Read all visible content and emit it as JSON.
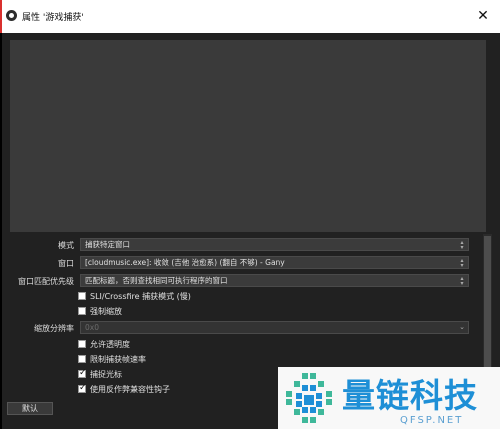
{
  "window": {
    "title": "属性 '游戏捕获'",
    "close": "✕"
  },
  "properties": {
    "mode": {
      "label": "模式",
      "value": "捕获特定窗口"
    },
    "window": {
      "label": "窗口",
      "value": "[cloudmusic.exe]: 收敛 (吉他 治愈系) (翻自 不够) - Gany"
    },
    "match_priority": {
      "label": "窗口匹配优先级",
      "value": "匹配标题，否则查找相同可执行程序的窗口"
    },
    "sli_crossfire": {
      "label": "SLI/Crossfire 捕获模式 (慢)",
      "checked": false
    },
    "force_scaling": {
      "label": "强制缩放",
      "checked": false
    },
    "scale_resolution": {
      "label": "缩放分辨率",
      "value": "0x0"
    },
    "allow_transparency": {
      "label": "允许透明度",
      "checked": false
    },
    "limit_framerate": {
      "label": "限制捕获帧速率",
      "checked": false
    },
    "capture_cursor": {
      "label": "捕捉光标",
      "checked": true
    },
    "anticheat_hook": {
      "label": "使用反作弊兼容性钩子",
      "checked": true
    }
  },
  "footer": {
    "defaults_label": "默认"
  },
  "watermark": {
    "text_cn": "量链科技",
    "text_en": "QFSP.NET"
  },
  "colors": {
    "dialog_bg": "#212121",
    "preview_bg": "#3a3a3a",
    "watermark_blue": "#1e8fd6"
  }
}
